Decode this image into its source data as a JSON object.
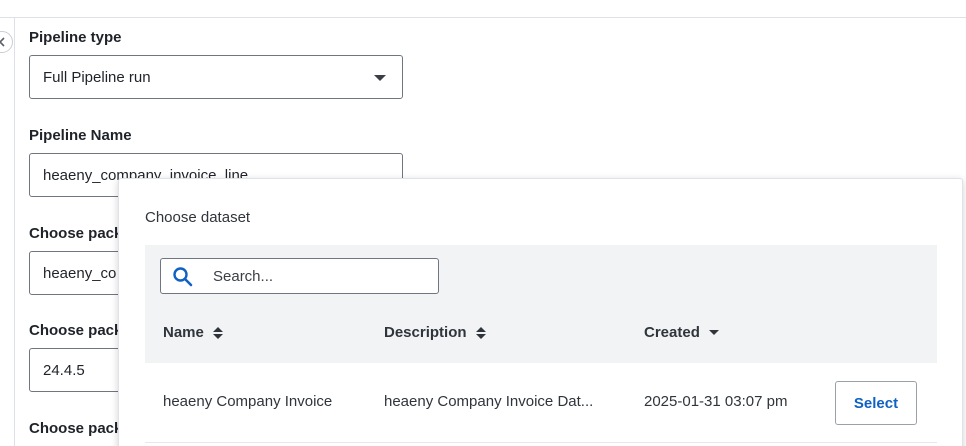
{
  "form": {
    "pipeline_type_label": "Pipeline type",
    "pipeline_type_value": "Full Pipeline run",
    "pipeline_name_label": "Pipeline Name",
    "pipeline_name_value": "heaeny_company_invoice_line",
    "package_label_1": "Choose pack",
    "package_value_1": "heaeny_co",
    "package_label_2": "Choose pack",
    "package_value_2": "24.4.5",
    "package_label_3": "Choose pack"
  },
  "dialog": {
    "title": "Choose dataset",
    "search_placeholder": "Search...",
    "columns": {
      "name": "Name",
      "description": "Description",
      "created": "Created"
    },
    "rows": [
      {
        "name": "heaeny Company Invoice",
        "description": "heaeny Company Invoice Dat...",
        "created": "2025-01-31 03:07 pm",
        "action": "Select"
      }
    ]
  },
  "colors": {
    "accent": "#0f62c4",
    "table_header_bg": "#f2f3f5",
    "border": "#6f7680"
  },
  "icons": [
    "chevron-left-icon",
    "caret-down-icon",
    "search-icon",
    "sort-icon"
  ]
}
